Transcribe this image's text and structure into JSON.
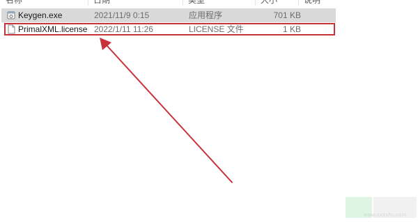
{
  "header": {
    "columns": [
      "名称",
      "日期",
      "类型",
      "大小",
      "说明"
    ]
  },
  "files": [
    {
      "icon": "exe-icon",
      "name": "Keygen.exe",
      "date": "2021/11/9 0:15",
      "type": "应用程序",
      "size": "701 KB",
      "selected": true
    },
    {
      "icon": "license-file-icon",
      "name": "PrimalXML.license",
      "date": "2022/1/11 11:26",
      "type": "LICENSE 文件",
      "size": "1 KB",
      "selected": false
    }
  ],
  "annotation": {
    "color": "#c8323a"
  },
  "watermark": {
    "text": "www.xxxxhu.com"
  }
}
